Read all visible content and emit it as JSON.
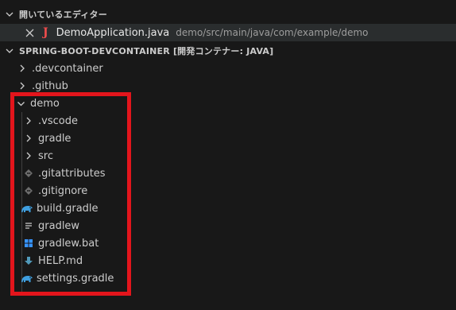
{
  "open_editors": {
    "header": "開いているエディター",
    "items": [
      {
        "name": "DemoApplication.java",
        "path": "demo/src/main/java/com/example/demo",
        "icon": "java-icon"
      }
    ]
  },
  "workspace": {
    "header": "SPRING-BOOT-DEVCONTAINER [開発コンテナー: JAVA]",
    "tree": [
      {
        "label": ".devcontainer",
        "kind": "folder",
        "expanded": false
      },
      {
        "label": ".github",
        "kind": "folder",
        "expanded": false
      },
      {
        "label": "demo",
        "kind": "folder",
        "expanded": true
      },
      {
        "label": ".vscode",
        "kind": "folder",
        "expanded": false
      },
      {
        "label": "gradle",
        "kind": "folder",
        "expanded": false
      },
      {
        "label": "src",
        "kind": "folder",
        "expanded": false
      },
      {
        "label": ".gitattributes",
        "kind": "file",
        "icon": "git-icon"
      },
      {
        "label": ".gitignore",
        "kind": "file",
        "icon": "git-icon"
      },
      {
        "label": "build.gradle",
        "kind": "file",
        "icon": "gradle-elephant-icon"
      },
      {
        "label": "gradlew",
        "kind": "file",
        "icon": "text-lines-icon"
      },
      {
        "label": "gradlew.bat",
        "kind": "file",
        "icon": "windows-icon"
      },
      {
        "label": "HELP.md",
        "kind": "file",
        "icon": "markdown-arrow-icon"
      },
      {
        "label": "settings.gradle",
        "kind": "file",
        "icon": "gradle-elephant-icon"
      }
    ]
  },
  "colors": {
    "highlight": "#e3151c",
    "java_icon": "#f14c4c",
    "gradle_icon": "#3f9fdf",
    "windows_icon": "#3794ff",
    "markdown_icon": "#519aba"
  }
}
